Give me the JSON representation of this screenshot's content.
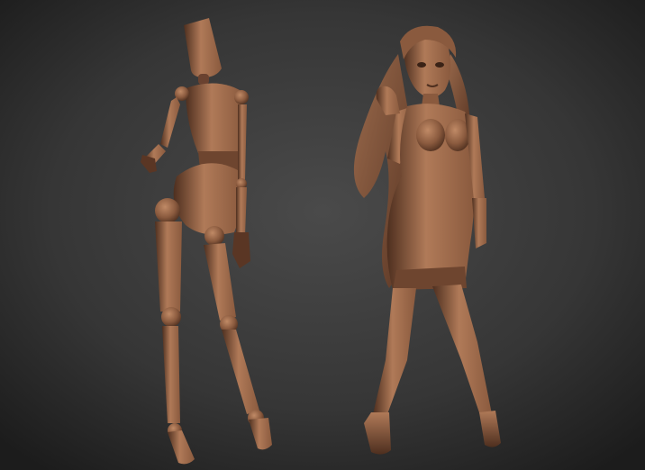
{
  "scene": {
    "colors": {
      "background_top": "#1c1c1c",
      "background_mid": "#4a4a4a",
      "background_bottom": "#2c2c2c",
      "clay_light": "#b07a58",
      "clay_mid": "#8a5a3e",
      "clay_dark": "#4e2f1f",
      "clay_shadow": "#2e1a10"
    },
    "objects": [
      "wooden-mannequin",
      "female-figure-sculpt"
    ]
  }
}
